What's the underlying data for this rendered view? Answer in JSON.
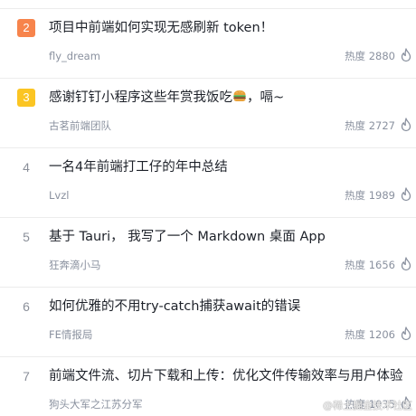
{
  "heat_label": "热度",
  "colors": {
    "rank2_bg": "#f7844c",
    "rank3_bg": "#fbc523",
    "title": "#1d2129",
    "meta": "#8a919f"
  },
  "items": [
    {
      "rank": "2",
      "title": "项目中前端如何实现无感刷新 token！",
      "author": "fly_dream",
      "heat": "2880",
      "badge": "orange"
    },
    {
      "rank": "3",
      "title": "感谢钉钉小程序这些年赏我饭吃",
      "title_suffix": "，嗝~",
      "emoji": "burger-icon",
      "author": "古茗前端团队",
      "heat": "2727",
      "badge": "yellow"
    },
    {
      "rank": "4",
      "title": "一名4年前端打工仔的年中总结",
      "author": "Lvzl",
      "heat": "1989",
      "badge": "plain"
    },
    {
      "rank": "5",
      "title": "基于 Tauri， 我写了一个 Markdown 桌面 App",
      "author": "狂奔滴小马",
      "heat": "1656",
      "badge": "plain"
    },
    {
      "rank": "6",
      "title": "如何优雅的不用try-catch捕获await的错误",
      "author": "FE情报局",
      "heat": "1206",
      "badge": "plain"
    },
    {
      "rank": "7",
      "title": "前端文件流、切片下载和上传：优化文件传输效率与用户体验",
      "author": "狗头大军之江苏分军",
      "heat": "1035",
      "badge": "plain"
    }
  ],
  "watermark": "@稀土掘金技术社区"
}
